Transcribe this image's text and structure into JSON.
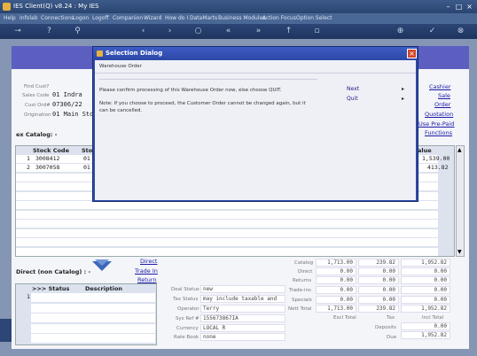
{
  "window": {
    "title": "IES Client(Q) v8.24 : My IES"
  },
  "menu": [
    "Help",
    "Infolab",
    "Connections",
    "Logon",
    "Logoff",
    "Companion",
    "Wizard",
    "How do I",
    "DataMarts",
    "Business Modules",
    "Action Focus",
    "Option Select"
  ],
  "order": {
    "find_cust_label": "Find Cust?",
    "sales_code_label": "Sales Code",
    "sales_code": "01 Indra",
    "cust_order_label": "Cust Ord#",
    "cust_order": "07306/22",
    "origination_label": "Origination",
    "origination": "01 Main Stor"
  },
  "actions": [
    "Cashier",
    "Sale",
    "Order",
    "Quotation",
    "Use Pre-Paid",
    "Functions"
  ],
  "catalog": {
    "heading": "ex Catalog: -",
    "columns": [
      "Stock Code",
      "Stor",
      "alue"
    ],
    "rows": [
      {
        "num": "1",
        "code": "3008412",
        "store": "01",
        "value": "1,539.00"
      },
      {
        "num": "2",
        "code": "3007058",
        "store": "01",
        "value": "413.82"
      }
    ]
  },
  "direct": {
    "heading": "Direct (non Catalog) : -",
    "links": [
      "Direct",
      "Trade In",
      "Return"
    ],
    "columns": [
      ">>> Status",
      "Description"
    ],
    "row_num": "1"
  },
  "deal": {
    "deal_status_label": "Deal Status",
    "deal_status": "new",
    "tax_status_label": "Tax Status",
    "tax_status": "may include taxable and",
    "operator_label": "Operator",
    "operator": "Terry",
    "sys_ref_label": "Sys Ref #",
    "sys_ref": "155673867IA",
    "currency_label": "Currency",
    "currency": "LOCAL R",
    "rate_book_label": "Rate Book",
    "rate_book": "none"
  },
  "totals": {
    "rows": [
      {
        "label": "Catalog",
        "excl": "1,713.00",
        "tax": "239.82",
        "incl": "1,952.82"
      },
      {
        "label": "Direct",
        "excl": "0.00",
        "tax": "0.00",
        "incl": "0.00"
      },
      {
        "label": "Returns",
        "excl": "0.00",
        "tax": "0.00",
        "incl": "0.00"
      },
      {
        "label": "Trade-ins",
        "excl": "0.00",
        "tax": "0.00",
        "incl": "0.00"
      },
      {
        "label": "Specials",
        "excl": "0.00",
        "tax": "0.00",
        "incl": "0.00"
      },
      {
        "label": "Nett Total",
        "excl": "1,713.00",
        "tax": "239.82",
        "incl": "1,952.82"
      }
    ],
    "excl_label": "Excl Total",
    "tax_label": "Tax",
    "incl_label": "Incl Total",
    "deposits_label": "Deposits",
    "deposits": "0.00",
    "due_label": "Due",
    "due": "1,952.82"
  },
  "dialog": {
    "title": "Selection Dialog",
    "subtitle": "Warehouse Order",
    "message": "Please confirm processing of this Warehouse Order now, else choose QUIT.",
    "note": "Note: If you choose to proceed, the Customer Order cannot be changed again, but it can be cancelled.",
    "options": [
      "Next",
      "Quit"
    ]
  },
  "colors": {
    "accent": "#2e4aa8",
    "banner": "#5c5fc0",
    "link": "#1a1aa8"
  }
}
